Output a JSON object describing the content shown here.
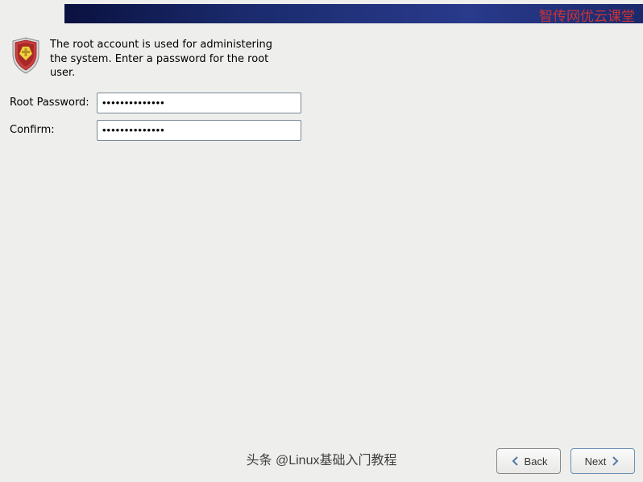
{
  "banner": {
    "watermark_top": "智传网优云课堂"
  },
  "intro": {
    "text": "The root account is used for administering the system.  Enter a password for the root user."
  },
  "form": {
    "root_password": {
      "label": "Root Password:",
      "value": "••••••••••••••"
    },
    "confirm": {
      "label": "Confirm:",
      "value": "••••••••••••••"
    }
  },
  "buttons": {
    "back": "Back",
    "next": "Next"
  },
  "watermark_bottom": "头条 @Linux基础入门教程"
}
